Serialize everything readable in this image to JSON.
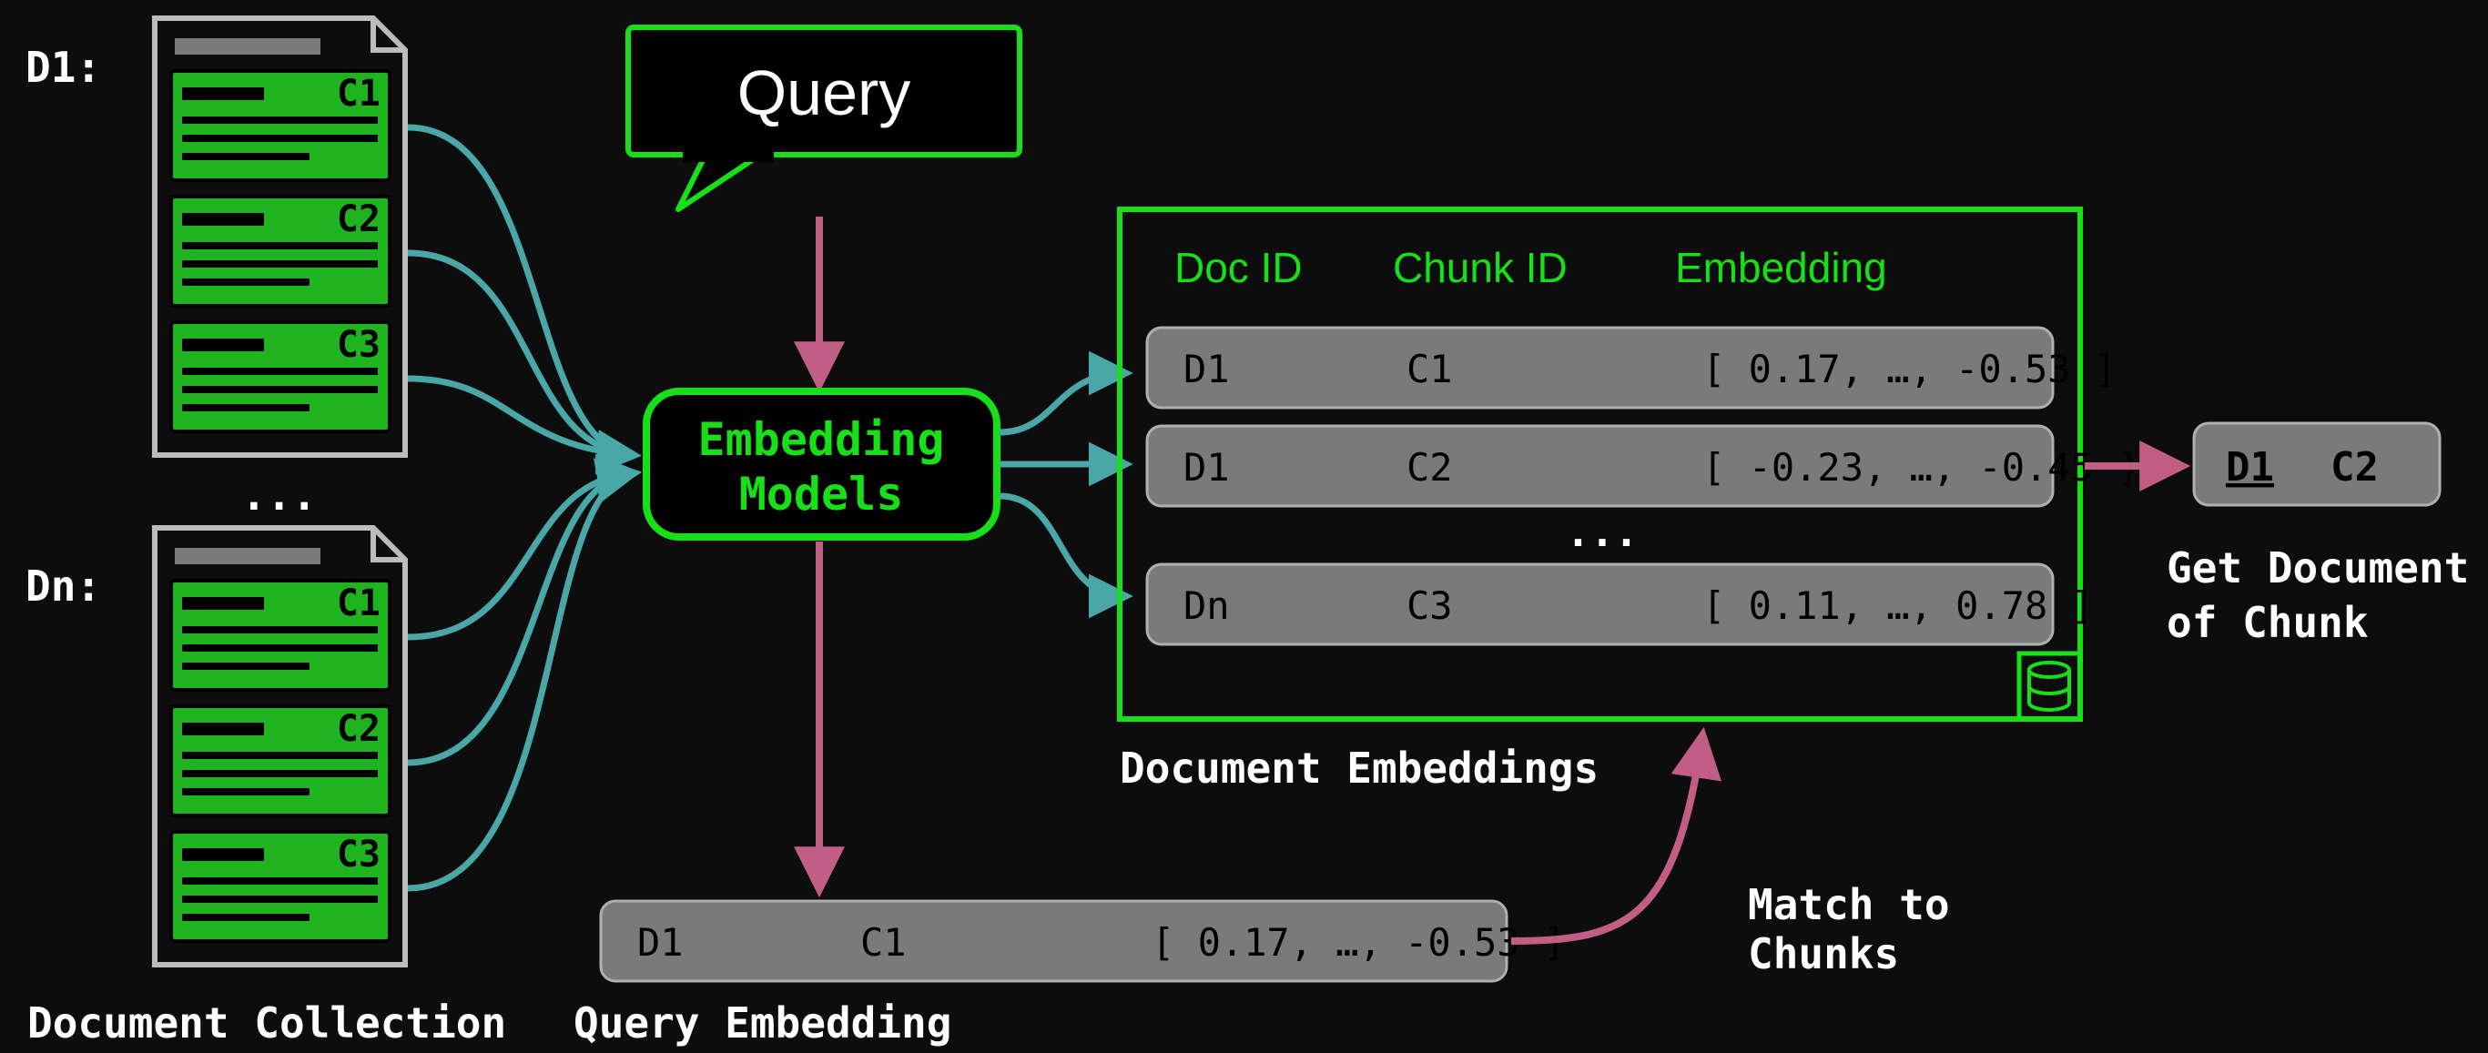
{
  "documents": {
    "d1_label": "D1:",
    "dn_label": "Dn:",
    "ellipsis": "...",
    "chunks_d1": [
      "C1",
      "C2",
      "C3"
    ],
    "chunks_dn": [
      "C1",
      "C2",
      "C3"
    ],
    "caption": "Document Collection"
  },
  "query": {
    "label": "Query"
  },
  "embedding_models": {
    "line1": "Embedding",
    "line2": "Models"
  },
  "query_embedding": {
    "doc": "D1",
    "chunk": "C1",
    "vec": "[ 0.17, …, -0.53 ]",
    "caption": "Query Embedding"
  },
  "table": {
    "headers": {
      "doc": "Doc ID",
      "chunk": "Chunk ID",
      "emb": "Embedding"
    },
    "rows": [
      {
        "doc": "D1",
        "chunk": "C1",
        "vec": "[ 0.17, …, -0.53 ]"
      },
      {
        "doc": "D1",
        "chunk": "C2",
        "vec": "[ -0.23, …, -0.45 ]"
      },
      {
        "doc": "Dn",
        "chunk": "C3",
        "vec": "[ 0.11, …,  0.78 ]"
      }
    ],
    "ellipsis": "...",
    "caption": "Document Embeddings"
  },
  "match_label": {
    "line1": "Match to",
    "line2": "Chunks"
  },
  "output": {
    "doc": "D1",
    "chunk": "C2",
    "caption1": "Get Document",
    "caption2": "of Chunk"
  }
}
